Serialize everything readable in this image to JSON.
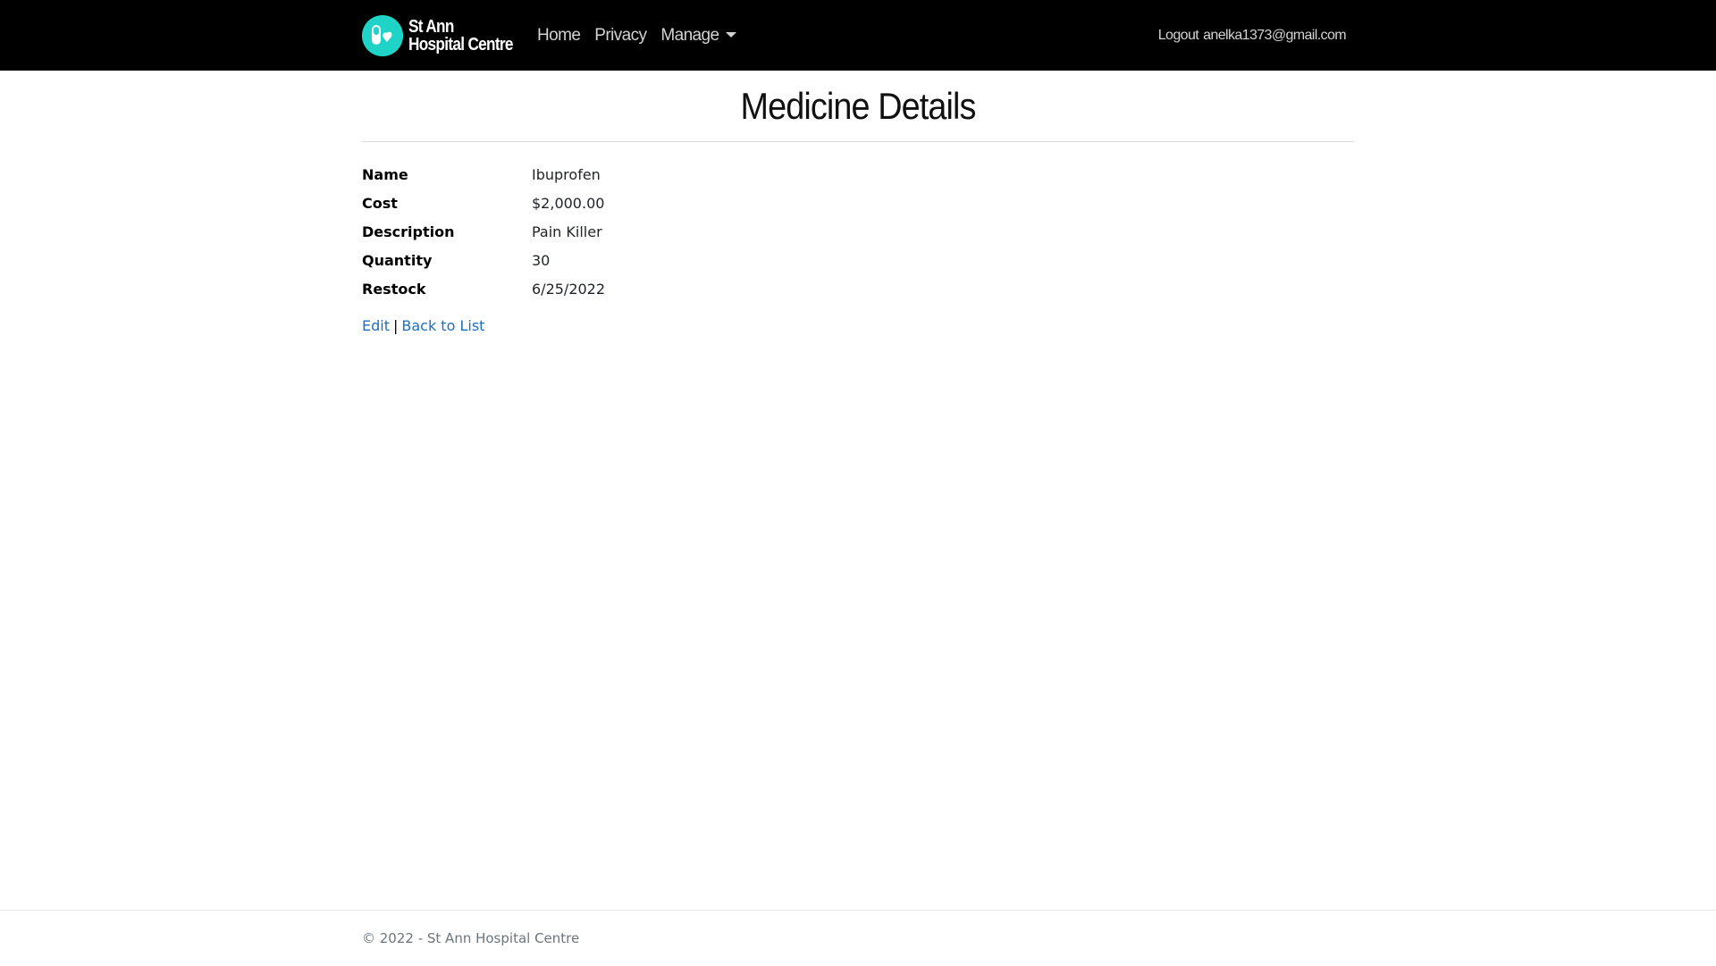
{
  "colors": {
    "navbar_bg": "#000000",
    "logo_accent": "#1fd3c6",
    "link": "#1b6ec2"
  },
  "header": {
    "brand_line1": "St Ann",
    "brand_line2": "Hospital Centre",
    "logo_icon": "pill-capsule-icon",
    "nav": {
      "home": "Home",
      "privacy": "Privacy",
      "manage": "Manage"
    },
    "logout_label": "Logout",
    "user_email": "anelka1373@gmail.com"
  },
  "main": {
    "title": "Medicine Details",
    "fields": [
      {
        "label": "Name",
        "value": "Ibuprofen"
      },
      {
        "label": "Cost",
        "value": "$2,000.00"
      },
      {
        "label": "Description",
        "value": "Pain Killer"
      },
      {
        "label": "Quantity",
        "value": "30"
      },
      {
        "label": "Restock",
        "value": "6/25/2022"
      }
    ],
    "actions": {
      "edit": "Edit",
      "separator": "|",
      "back": "Back to List"
    }
  },
  "footer": {
    "text": "© 2022 - St Ann Hospital Centre"
  }
}
